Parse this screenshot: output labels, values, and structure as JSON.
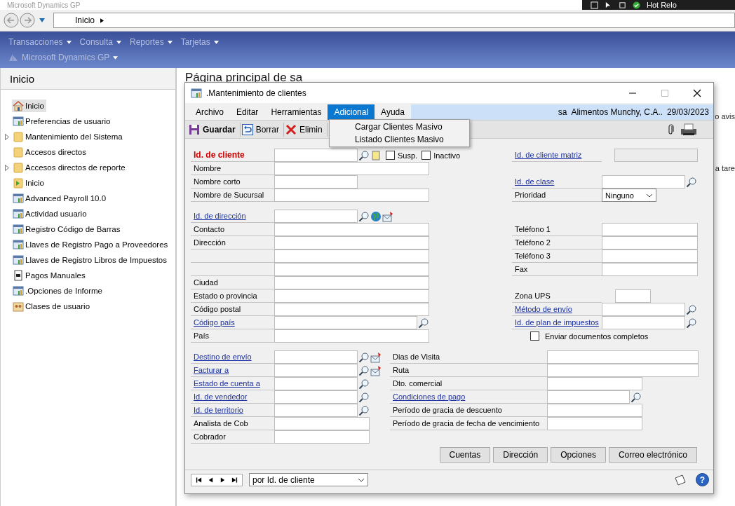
{
  "app_title": "Microsoft Dynamics GP",
  "tray": {
    "label": "Hot Relo"
  },
  "address_bar": {
    "path": "Inicio"
  },
  "menu_bar": [
    {
      "label": "Transacciones"
    },
    {
      "label": "Consulta"
    },
    {
      "label": "Reportes"
    },
    {
      "label": "Tarjetas"
    }
  ],
  "product_menu": {
    "label": "Microsoft Dynamics GP"
  },
  "navigation_pane": {
    "title": "Inicio",
    "items": [
      {
        "label": "Inicio",
        "kind": "home",
        "expandable": false,
        "selected": true
      },
      {
        "label": "Preferencias de usuario",
        "kind": "window",
        "expandable": false,
        "selected": false
      },
      {
        "label": "Mantenimiento del Sistema",
        "kind": "folder",
        "expandable": true,
        "selected": false
      },
      {
        "label": "Accesos directos",
        "kind": "folder",
        "expandable": false,
        "selected": false
      },
      {
        "label": "Accesos directos de reporte",
        "kind": "folder",
        "expandable": true,
        "selected": false
      },
      {
        "label": "Inicio",
        "kind": "launcher",
        "expandable": false,
        "selected": false
      },
      {
        "label": "Advanced Payroll 10.0",
        "kind": "window",
        "expandable": false,
        "selected": false
      },
      {
        "label": "Actividad usuario",
        "kind": "window",
        "expandable": false,
        "selected": false
      },
      {
        "label": "Registro Código de Barras",
        "kind": "window",
        "expandable": false,
        "selected": false
      },
      {
        "label": "Llaves de Registro Pago a Proveedores",
        "kind": "window",
        "expandable": false,
        "selected": false
      },
      {
        "label": "Llaves de Registro Libros de Impuestos",
        "kind": "window",
        "expandable": false,
        "selected": false
      },
      {
        "label": "Pagos Manuales",
        "kind": "document",
        "expandable": false,
        "selected": false
      },
      {
        "label": ".Opciones de Informe",
        "kind": "window",
        "expandable": false,
        "selected": false
      },
      {
        "label": "Clases de usuario",
        "kind": "users",
        "expandable": false,
        "selected": false
      }
    ]
  },
  "home_page": {
    "title": "Página principal de sa",
    "fragments": [
      "o avis",
      "a tare"
    ]
  },
  "dialog": {
    "title": ".Mantenimiento de clientes",
    "menu": [
      {
        "label": "Archivo",
        "selected": false
      },
      {
        "label": "Editar",
        "selected": false
      },
      {
        "label": "Herramientas",
        "selected": false
      },
      {
        "label": "Adicional",
        "selected": true
      },
      {
        "label": "Ayuda",
        "selected": false
      }
    ],
    "open_menu": [
      {
        "label": "Cargar Clientes Masivo"
      },
      {
        "label": "Listado Clientes Masivo"
      }
    ],
    "session": {
      "user": "sa",
      "company": "Alimentos Munchy, C.A..",
      "date": "29/03/2023"
    },
    "toolbar": [
      {
        "label": "Guardar",
        "kind": "save"
      },
      {
        "label": "Borrar",
        "kind": "clear"
      },
      {
        "label": "Elimin",
        "kind": "delete"
      }
    ],
    "sections": [
      {
        "left": [
          {
            "label": "Id. de cliente",
            "kind": "lookup",
            "link": false,
            "required": true,
            "checkboxes": [
              {
                "label": "Susp.",
                "checked": false
              },
              {
                "label": "Inactivo",
                "checked": false
              }
            ]
          },
          {
            "label": "Nombre",
            "kind": "text",
            "link": false,
            "required": false
          },
          {
            "label": "Nombre corto",
            "kind": "text",
            "link": false,
            "required": false
          },
          {
            "label": "Nombre de Sucursal",
            "kind": "text",
            "link": false,
            "required": false
          }
        ],
        "right": [
          {
            "label": "Id. de cliente matriz",
            "kind": "disabled",
            "link": true,
            "required": false
          },
          {
            "kind": "spacer"
          },
          {
            "label": "Id. de clase",
            "kind": "lookup",
            "link": true,
            "required": false
          },
          {
            "label": "Prioridad",
            "kind": "select",
            "link": false,
            "required": false,
            "value": "Ninguno"
          }
        ]
      },
      {
        "left": [
          {
            "label": "Id. de dirección",
            "kind": "lookup",
            "link": true,
            "required": false
          },
          {
            "label": "Contacto",
            "kind": "text",
            "link": false,
            "required": false
          },
          {
            "label": "Dirección",
            "kind": "text",
            "link": false,
            "required": false
          },
          {
            "kind": "text"
          },
          {
            "kind": "text"
          },
          {
            "label": "Ciudad",
            "kind": "text",
            "link": false,
            "required": false
          },
          {
            "label": "Estado o provincia",
            "kind": "text",
            "link": false,
            "required": false
          },
          {
            "label": "Código postal",
            "kind": "text",
            "link": false,
            "required": false
          },
          {
            "label": "Código país",
            "kind": "lookup",
            "link": true,
            "required": false
          },
          {
            "label": "País",
            "kind": "text",
            "link": false,
            "required": false
          }
        ],
        "right": [
          {
            "kind": "spacer"
          },
          {
            "label": "Teléfono 1",
            "kind": "text",
            "link": false,
            "required": false
          },
          {
            "label": "Teléfono 2",
            "kind": "text",
            "link": false,
            "required": false
          },
          {
            "label": "Teléfono 3",
            "kind": "text",
            "link": false,
            "required": false
          },
          {
            "label": "Fax",
            "kind": "text",
            "link": false,
            "required": false
          },
          {
            "kind": "spacer"
          },
          {
            "label": "Zona UPS",
            "kind": "text",
            "link": false,
            "required": false
          },
          {
            "label": "Método de envío",
            "kind": "lookup",
            "link": true,
            "required": false
          },
          {
            "label": "Id. de plan de impuestos",
            "kind": "lookup",
            "link": true,
            "required": false
          },
          {
            "label": "Enviar documentos completos",
            "kind": "checkbox",
            "checked": false
          }
        ]
      },
      {
        "left": [
          {
            "label": "Destino de envío",
            "kind": "lookup",
            "link": true,
            "required": false
          },
          {
            "label": "Facturar a",
            "kind": "lookup",
            "link": true,
            "required": false
          },
          {
            "label": "Estado de cuenta a",
            "kind": "lookup",
            "link": true,
            "required": false
          },
          {
            "label": "Id. de vendedor",
            "kind": "lookup",
            "link": true,
            "required": false
          },
          {
            "label": "Id. de territorio",
            "kind": "lookup",
            "link": true,
            "required": false
          },
          {
            "label": "Analista de Cob",
            "kind": "text",
            "link": false,
            "required": false
          },
          {
            "label": "Cobrador",
            "kind": "text",
            "link": false,
            "required": false
          }
        ],
        "right": [
          {
            "label": "Dias de Visita",
            "kind": "text",
            "link": false,
            "required": false
          },
          {
            "label": "Ruta",
            "kind": "text",
            "link": false,
            "required": false
          },
          {
            "label": "Dto. comercial",
            "kind": "text",
            "link": false,
            "required": false
          },
          {
            "label": "Condiciones de pago",
            "kind": "lookup",
            "link": true,
            "required": false
          },
          {
            "label": "Período de gracia de descuento",
            "kind": "text",
            "link": false,
            "required": false
          },
          {
            "label": "Período de gracia de fecha de vencimiento",
            "kind": "text",
            "link": false,
            "required": false
          }
        ]
      }
    ],
    "buttons": [
      "Cuentas",
      "Dirección",
      "Opciones",
      "Correo electrónico"
    ],
    "footer": {
      "sort": "por Id. de cliente",
      "help": "?"
    }
  }
}
